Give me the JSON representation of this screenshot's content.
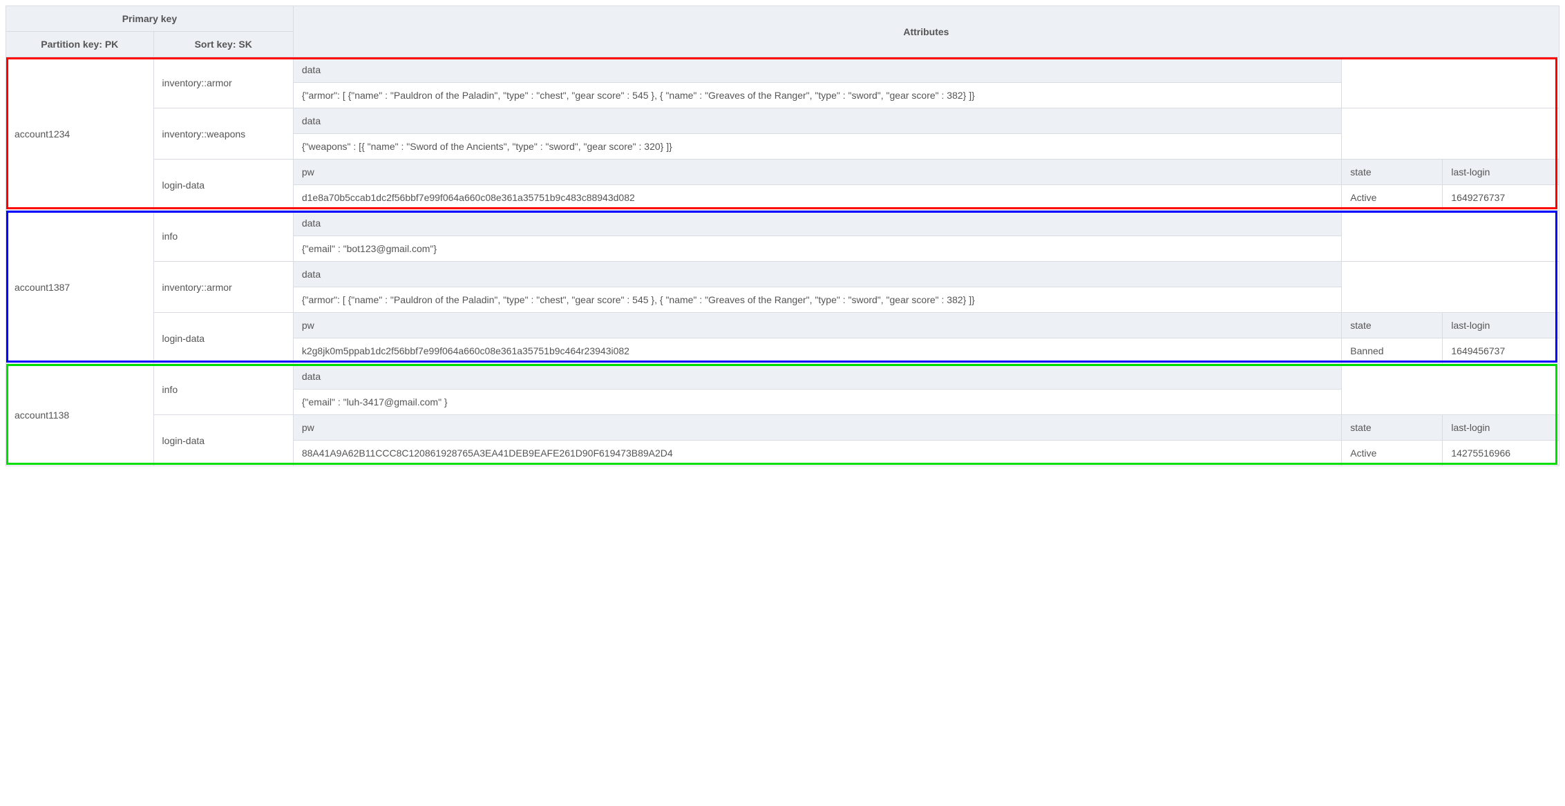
{
  "header": {
    "primary_key": "Primary key",
    "attributes": "Attributes",
    "partition_key": "Partition key: PK",
    "sort_key": "Sort key: SK"
  },
  "attr_labels": {
    "data": "data",
    "pw": "pw",
    "state": "state",
    "last_login": "last-login"
  },
  "accounts": [
    {
      "highlight": "red",
      "pk": "account1234",
      "items": [
        {
          "sk": "inventory::armor",
          "cols": [
            "data"
          ],
          "vals": [
            "{\"armor\": [ {\"name\" : \"Pauldron of the Paladin\", \"type\" : \"chest\", \"gear score\" : 545 }, { \"name\" : \"Greaves of the Ranger\", \"type\" : \"sword\", \"gear score\" : 382} ]}"
          ]
        },
        {
          "sk": "inventory::weapons",
          "cols": [
            "data"
          ],
          "vals": [
            "{\"weapons\" : [{ \"name\" : \"Sword of the Ancients\", \"type\" : \"sword\", \"gear score\" : 320} ]}"
          ]
        },
        {
          "sk": "login-data",
          "cols": [
            "pw",
            "state",
            "last-login"
          ],
          "vals": [
            "d1e8a70b5ccab1dc2f56bbf7e99f064a660c08e361a35751b9c483c88943d082",
            "Active",
            "1649276737"
          ]
        }
      ]
    },
    {
      "highlight": "blue",
      "pk": "account1387",
      "items": [
        {
          "sk": "info",
          "cols": [
            "data"
          ],
          "vals": [
            "{\"email\" : \"bot123@gmail.com\"}"
          ]
        },
        {
          "sk": "inventory::armor",
          "cols": [
            "data"
          ],
          "vals": [
            "{\"armor\": [ {\"name\" : \"Pauldron of the Paladin\", \"type\" : \"chest\", \"gear score\" : 545 }, { \"name\" : \"Greaves of the Ranger\", \"type\" : \"sword\", \"gear score\" : 382} ]}"
          ]
        },
        {
          "sk": "login-data",
          "cols": [
            "pw",
            "state",
            "last-login"
          ],
          "vals": [
            "k2g8jk0m5ppab1dc2f56bbf7e99f064a660c08e361a35751b9c464r23943i082",
            "Banned",
            "1649456737"
          ]
        }
      ]
    },
    {
      "highlight": "green",
      "pk": "account1138",
      "items": [
        {
          "sk": "info",
          "cols": [
            "data"
          ],
          "vals": [
            "{\"email\" : \"luh-3417@gmail.com\" }"
          ]
        },
        {
          "sk": "login-data",
          "cols": [
            "pw",
            "state",
            "last-login"
          ],
          "vals": [
            "88A41A9A62B11CCC8C120861928765A3EA41DEB9EAFE261D90F619473B89A2D4",
            "Active",
            "14275516966"
          ]
        }
      ]
    }
  ]
}
